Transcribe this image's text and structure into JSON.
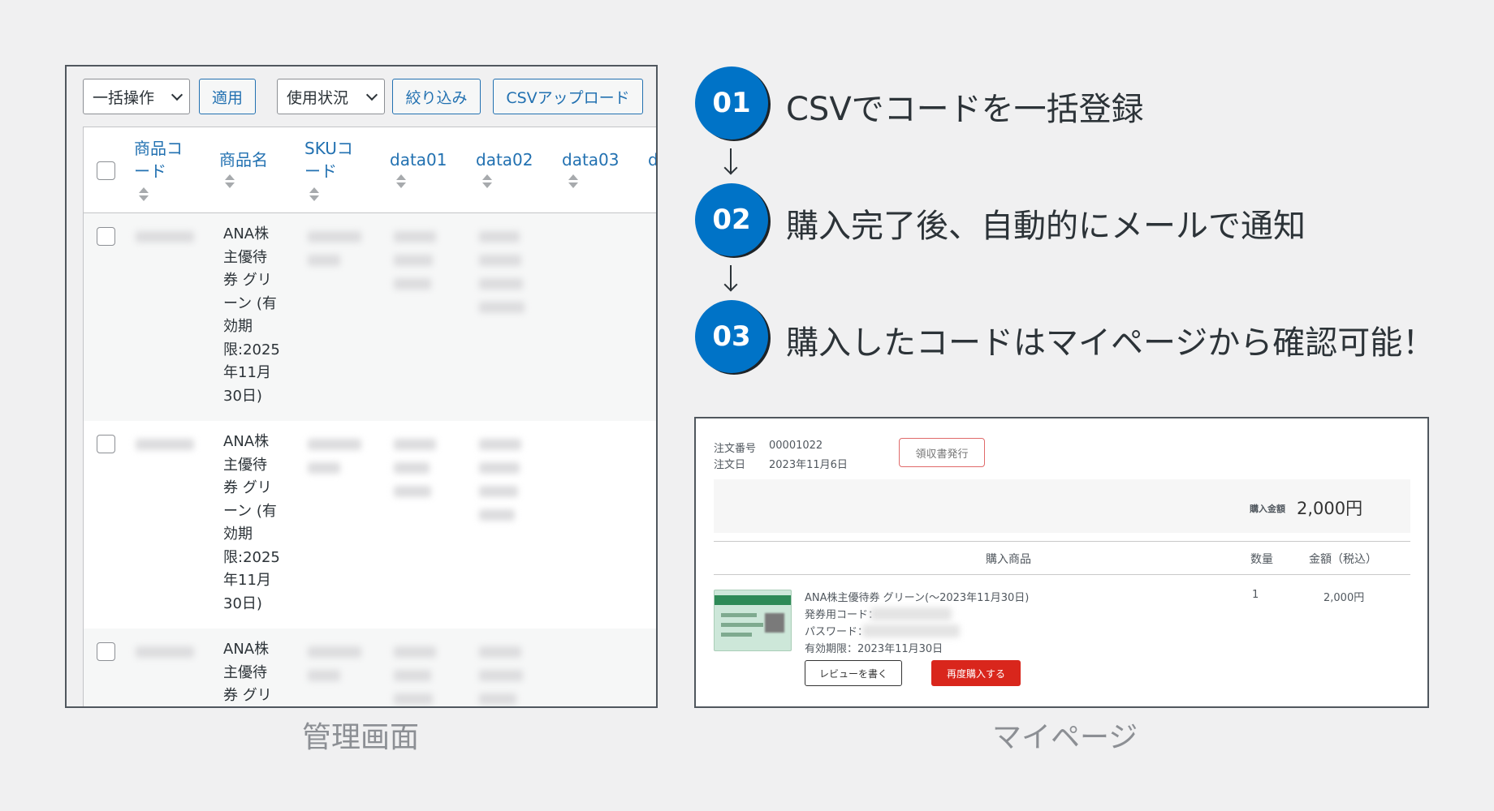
{
  "admin": {
    "toolbar": {
      "bulk_action": "一括操作",
      "apply": "適用",
      "usage_status": "使用状況",
      "filter": "絞り込み",
      "csv_upload": "CSVアップロード"
    },
    "columns": {
      "product_code_l1": "商品コ",
      "product_code_l2": "ード",
      "product_name": "商品名",
      "sku_l1": "SKUコ",
      "sku_l2": "ード",
      "data01": "data01",
      "data02": "data02",
      "data03": "data03",
      "cut_off": "d"
    },
    "rows": [
      {
        "name_lines": [
          "ANA株",
          "主優待",
          "券 グリ",
          "ーン (有",
          "効期",
          "限:2025",
          "年11月",
          "30日)"
        ]
      },
      {
        "name_lines": [
          "ANA株",
          "主優待",
          "券 グリ",
          "ーン (有",
          "効期",
          "限:2025",
          "年11月",
          "30日)"
        ]
      },
      {
        "name_lines": [
          "ANA株",
          "主優待",
          "券 グリ"
        ]
      }
    ],
    "caption": "管理画面"
  },
  "steps": [
    {
      "number": "01",
      "text": "CSVでコードを一括登録"
    },
    {
      "number": "02",
      "text": "購入完了後、自動的にメールで通知"
    },
    {
      "number": "03",
      "text": "購入したコードはマイページから確認可能！"
    }
  ],
  "mypage": {
    "order_number_label": "注文番号",
    "order_number": "00001022",
    "order_date_label": "注文日",
    "order_date": "2023年11月6日",
    "receipt_button": "領収書発行",
    "total_label": "購入金額",
    "total_value": "2,000円",
    "col_item": "購入商品",
    "col_qty": "数量",
    "col_price": "金額（税込）",
    "item_name": "ANA株主優待券 グリーン(〜2023年11月30日)",
    "ticket_code_label": "発券用コード：",
    "password_label": "パスワード：",
    "expiry": "有効期限：2023年11月30日",
    "qty": "1",
    "price": "2,000円",
    "review_button": "レビューを書く",
    "rebuy_button": "再度購入する",
    "caption": "マイページ"
  }
}
